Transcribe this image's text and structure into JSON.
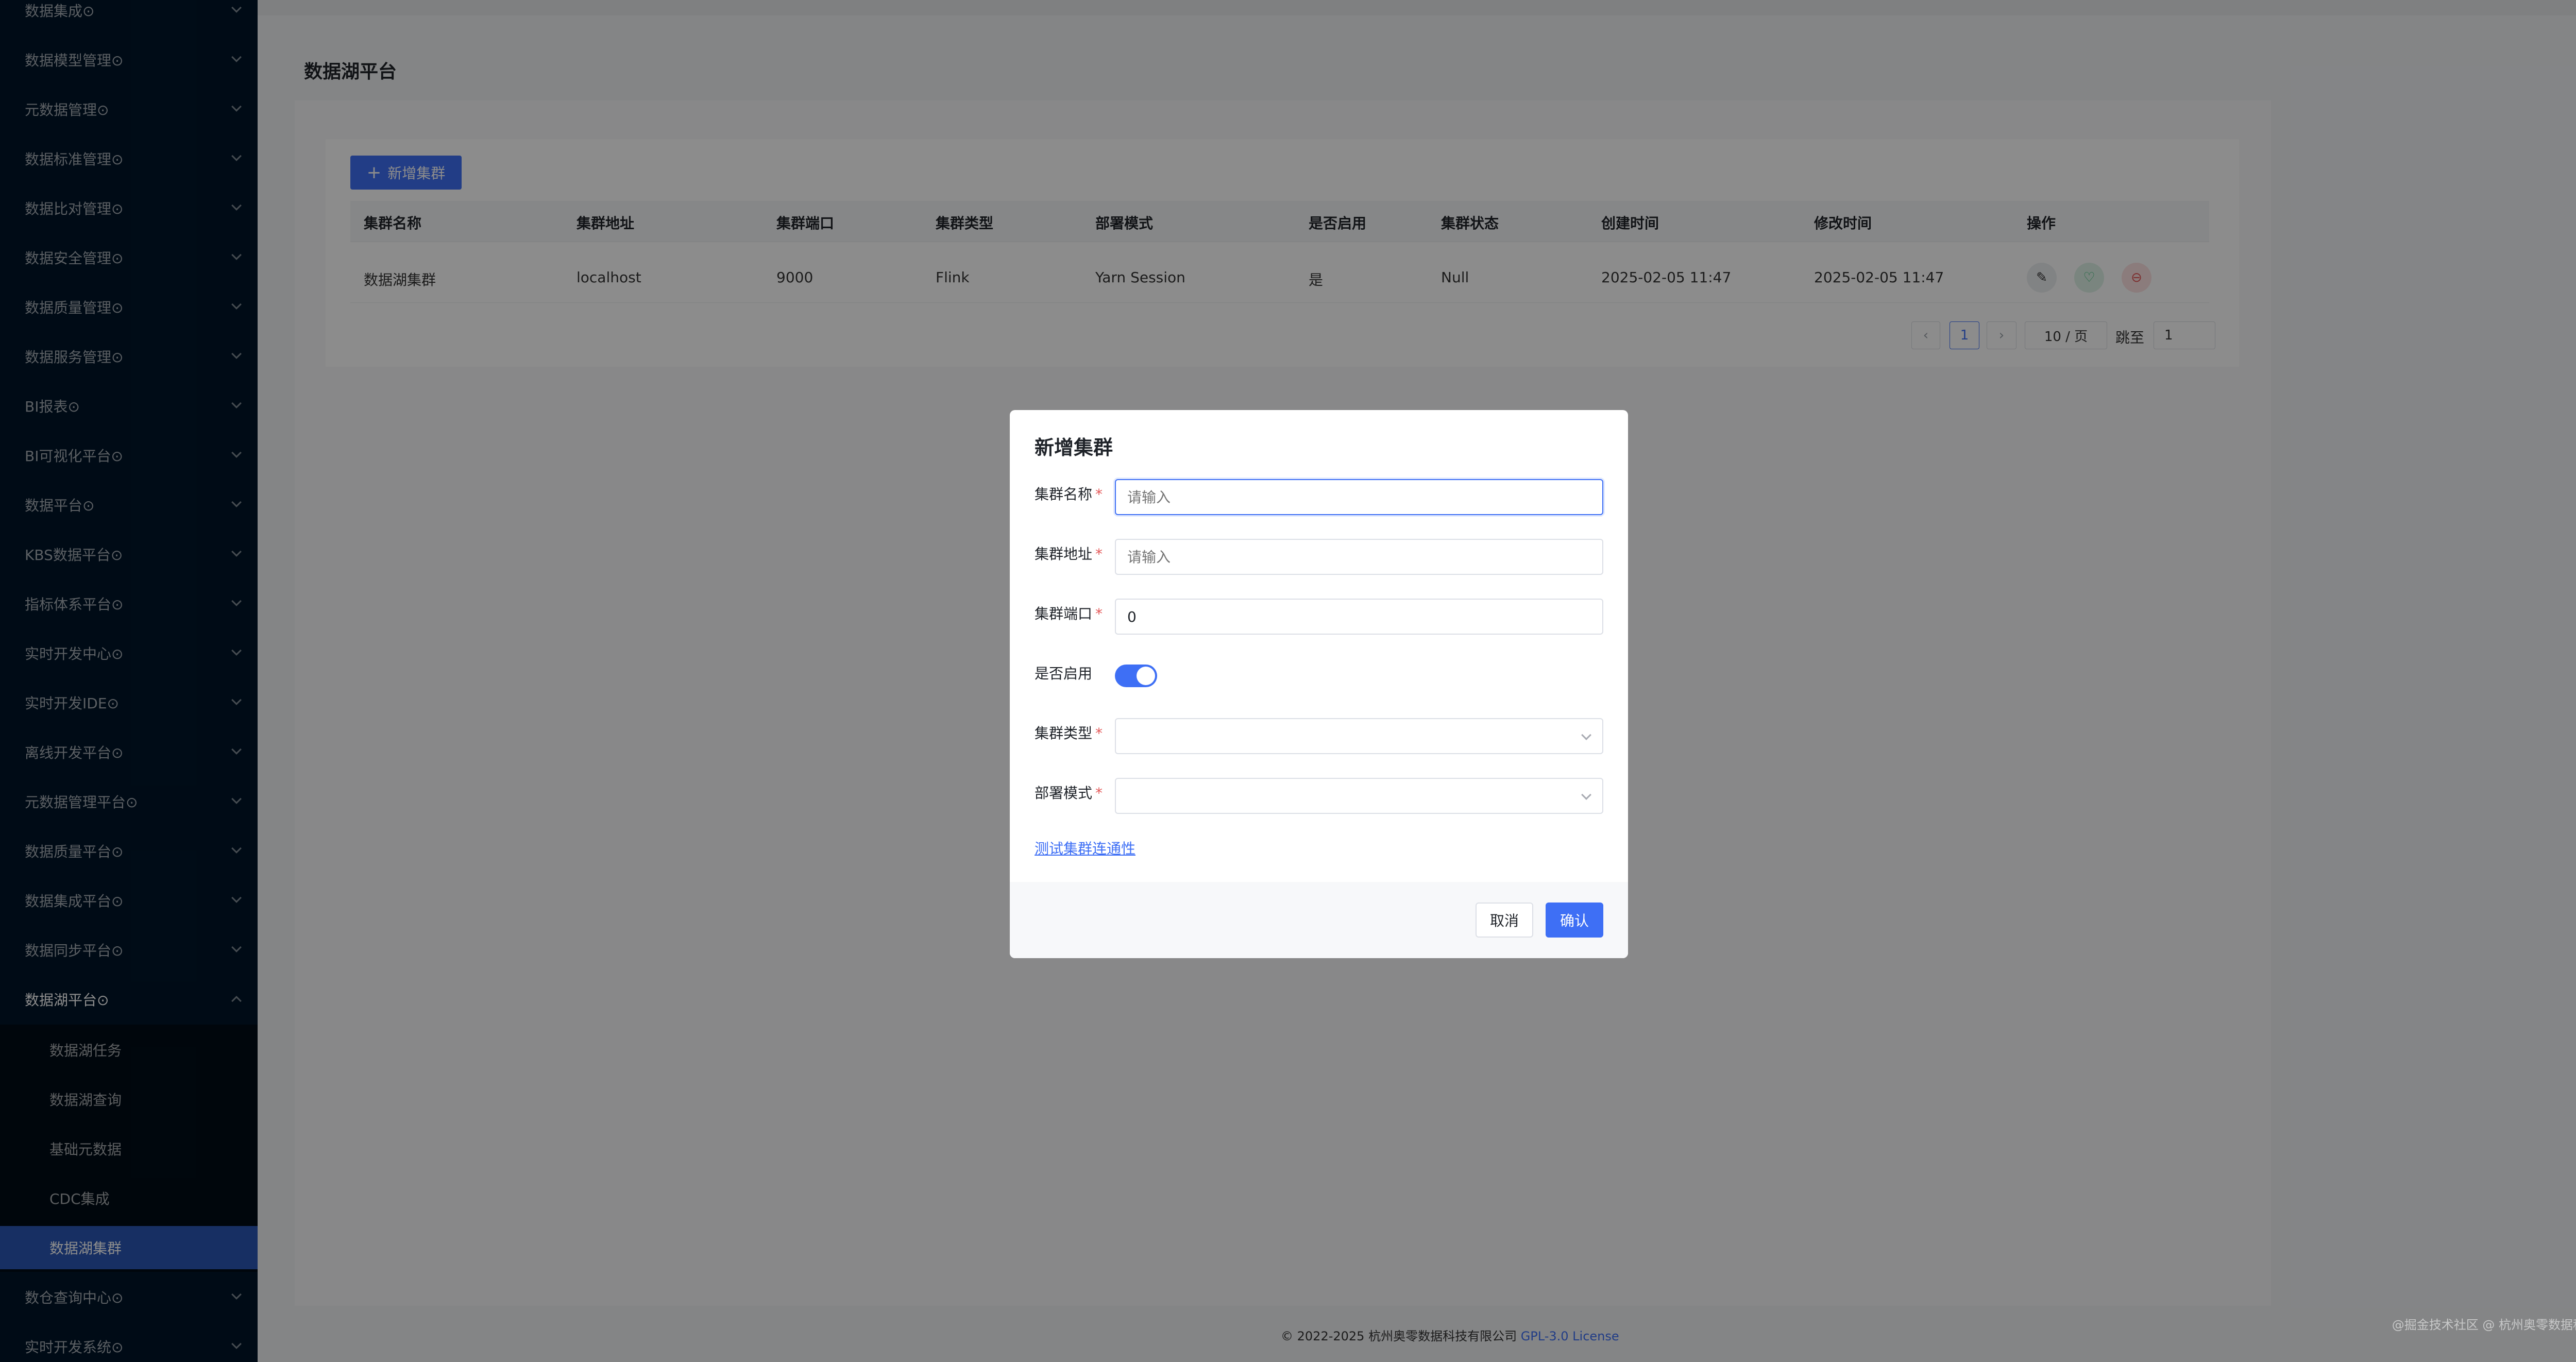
{
  "sidebar": {
    "items": [
      {
        "label": "数据集成⊙"
      },
      {
        "label": "数据模型管理⊙"
      },
      {
        "label": "元数据管理⊙"
      },
      {
        "label": "数据标准管理⊙"
      },
      {
        "label": "数据比对管理⊙"
      },
      {
        "label": "数据安全管理⊙"
      },
      {
        "label": "数据质量管理⊙"
      },
      {
        "label": "数据服务管理⊙"
      },
      {
        "label": "BI报表⊙"
      },
      {
        "label": "BI可视化平台⊙"
      },
      {
        "label": "数据平台⊙"
      },
      {
        "label": "KBS数据平台⊙"
      },
      {
        "label": "指标体系平台⊙"
      },
      {
        "label": "实时开发中心⊙"
      },
      {
        "label": "实时开发IDE⊙"
      },
      {
        "label": "离线开发平台⊙"
      },
      {
        "label": "元数据管理平台⊙"
      },
      {
        "label": "数据质量平台⊙"
      },
      {
        "label": "数据集成平台⊙"
      },
      {
        "label": "数据同步平台⊙"
      },
      {
        "label": "数据湖平台⊙"
      }
    ],
    "sub_items": [
      {
        "label": "数据湖任务"
      },
      {
        "label": "数据湖查询"
      },
      {
        "label": "基础元数据"
      },
      {
        "label": "CDC集成"
      },
      {
        "label": "数据湖集群"
      }
    ],
    "bottom_items": [
      {
        "label": "数仓查询中心⊙"
      },
      {
        "label": "实时开发系统⊙"
      }
    ]
  },
  "page": {
    "title": "数据湖平台",
    "add_button": "新增集群"
  },
  "table": {
    "columns": [
      "集群名称",
      "集群地址",
      "集群端口",
      "集群类型",
      "部署模式",
      "是否启用",
      "集群状态",
      "创建时间",
      "修改时间",
      "操作"
    ],
    "rows": [
      [
        "数据湖集群",
        "localhost",
        "9000",
        "Flink",
        "Yarn Session",
        "是",
        "Null",
        "2025-02-05 11:47",
        "2025-02-05 11:47"
      ]
    ]
  },
  "pagination": {
    "prev": "‹",
    "current": "1",
    "next": "›",
    "page_size": "10 / 页",
    "jump_label": "跳至",
    "jump_value": "1"
  },
  "footer": {
    "copyright": "© 2022-2025 杭州奥零数据科技有限公司 ",
    "license": "GPL-3.0 License"
  },
  "watermark": "@掘金技术社区 @ 杭州奥零数据科技",
  "modal": {
    "title": "新增集群",
    "fields": {
      "name_label": "集群名称",
      "name_placeholder": "请输入",
      "address_label": "集群地址",
      "address_placeholder": "请输入",
      "port_label": "集群端口",
      "port_value": "0",
      "enabled_label": "是否启用",
      "enabled_value": true,
      "type_label": "集群类型",
      "deploy_label": "部署模式",
      "required_mark": "*"
    },
    "test_link": "测试集群连通性",
    "cancel": "取消",
    "confirm": "确认"
  },
  "colors": {
    "primary": "#3e6ff5",
    "sidebar_bg": "#001529",
    "sidebar_active": "#2a56b4",
    "danger": "#e45858",
    "success": "#3fbf7a"
  },
  "icons": {
    "add": "plus-icon",
    "edit": "edit-icon",
    "enable": "heart-icon",
    "delete": "minus-circle-icon",
    "expand": "chevron-down-icon",
    "collapse": "chevron-up-icon",
    "select": "chevron-down-icon"
  }
}
